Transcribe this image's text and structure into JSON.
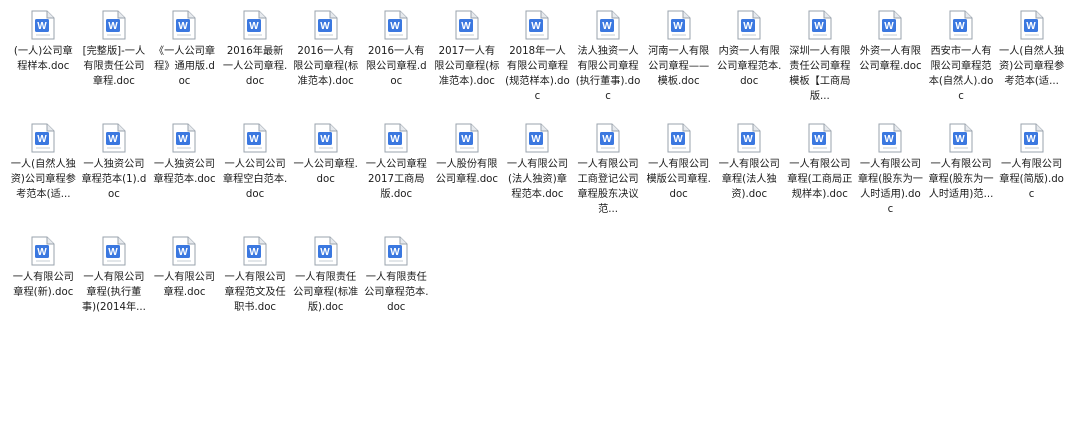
{
  "icon": {
    "name": "word-document-icon",
    "letter": "W",
    "color": "#3b78e0"
  },
  "files": [
    {
      "label": "(一人)公司章程样本.doc"
    },
    {
      "label": "[完整版]-一人有限责任公司章程.doc"
    },
    {
      "label": "《一人公司章程》通用版.doc"
    },
    {
      "label": "2016年最新一人公司章程.doc"
    },
    {
      "label": "2016一人有限公司章程(标准范本).doc"
    },
    {
      "label": "2016一人有限公司章程.doc"
    },
    {
      "label": "2017一人有限公司章程(标准范本).doc"
    },
    {
      "label": "2018年一人有限公司章程(规范样本).doc"
    },
    {
      "label": "法人独资一人有限公司章程(执行董事).doc"
    },
    {
      "label": "河南一人有限公司章程——模板.doc"
    },
    {
      "label": "内资一人有限公司章程范本.doc"
    },
    {
      "label": "深圳一人有限责任公司章程模板【工商局版..."
    },
    {
      "label": "外资一人有限公司章程.doc"
    },
    {
      "label": "西安市一人有限公司章程范本(自然人).doc"
    },
    {
      "label": "一人(自然人独资)公司章程参考范本(适..."
    },
    {
      "label": "一人(自然人独资)公司章程参考范本(适..."
    },
    {
      "label": "一人独资公司章程范本(1).doc"
    },
    {
      "label": "一人独资公司章程范本.doc"
    },
    {
      "label": "一人公司公司章程空白范本.doc"
    },
    {
      "label": "一人公司章程.doc"
    },
    {
      "label": "一人公司章程2017工商局版.doc"
    },
    {
      "label": "一人股份有限公司章程.doc"
    },
    {
      "label": "一人有限公司(法人独资)章程范本.doc"
    },
    {
      "label": "一人有限公司工商登记公司章程股东决议范..."
    },
    {
      "label": "一人有限公司模版公司章程.doc"
    },
    {
      "label": "一人有限公司章程(法人独资).doc"
    },
    {
      "label": "一人有限公司章程(工商局正规样本).doc"
    },
    {
      "label": "一人有限公司章程(股东为一人时适用).doc"
    },
    {
      "label": "一人有限公司章程(股东为一人时适用)范..."
    },
    {
      "label": "一人有限公司章程(简版).doc"
    },
    {
      "label": "一人有限公司章程(新).doc"
    },
    {
      "label": "一人有限公司章程(执行董事)(2014年..."
    },
    {
      "label": "一人有限公司章程.doc"
    },
    {
      "label": "一人有限公司章程范文及任职书.doc"
    },
    {
      "label": "一人有限责任公司章程(标准版).doc"
    },
    {
      "label": "一人有限责任公司章程范本.doc"
    }
  ]
}
